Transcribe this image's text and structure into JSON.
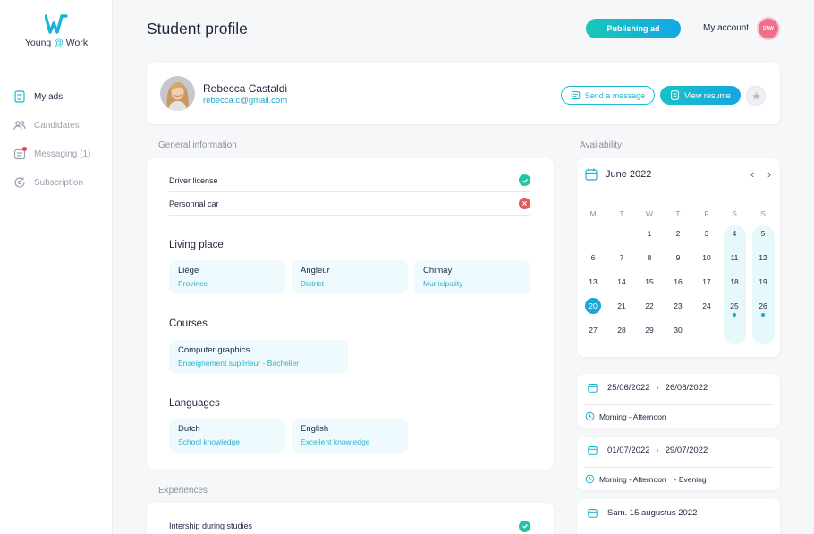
{
  "brand": {
    "name_left": "Young",
    "name_at": "@",
    "name_right": "Work"
  },
  "nav": [
    {
      "label": "My ads",
      "icon": "document-icon",
      "active": true
    },
    {
      "label": "Candidates",
      "icon": "users-icon",
      "active": false
    },
    {
      "label": "Messaging (1)",
      "icon": "message-icon",
      "active": false
    },
    {
      "label": "Subscription",
      "icon": "subscription-icon",
      "active": false
    }
  ],
  "header": {
    "title": "Student profile",
    "publish_label": "Publishing ad",
    "account_label": "My account",
    "account_badge": "DAW"
  },
  "profile": {
    "name": "Rebecca Castaldi",
    "email": "rebecca.c@gmail.com",
    "message_label": "Send a message",
    "resume_label": "View resume"
  },
  "general": {
    "section_label": "General information",
    "attributes": [
      {
        "label": "Driver license",
        "status": "ok"
      },
      {
        "label": "Personnal car",
        "status": "no"
      }
    ],
    "living_heading": "Living place",
    "living": [
      {
        "title": "Liège",
        "sub": "Province"
      },
      {
        "title": "Angleur",
        "sub": "District"
      },
      {
        "title": "Chimay",
        "sub": "Municipality"
      }
    ],
    "courses_heading": "Courses",
    "courses": [
      {
        "title": "Computer graphics",
        "sub": "Enseignement supérieur - Bachelier"
      }
    ],
    "languages_heading": "Languages",
    "languages": [
      {
        "title": "Dutch",
        "sub": "School knowledge"
      },
      {
        "title": "English",
        "sub": "Excellent knowledge"
      }
    ]
  },
  "experiences": {
    "section_label": "Experiences",
    "items": [
      {
        "label": "Intership during studies",
        "status": "ok"
      }
    ]
  },
  "availability": {
    "section_label": "Availability",
    "month": "June 2022",
    "weekdays": [
      "M",
      "T",
      "W",
      "T",
      "F",
      "S",
      "S"
    ],
    "weeks": [
      [
        "",
        "",
        "1",
        "2",
        "3",
        "4",
        "5"
      ],
      [
        "6",
        "7",
        "8",
        "9",
        "10",
        "11",
        "12"
      ],
      [
        "13",
        "14",
        "15",
        "16",
        "17",
        "18",
        "19"
      ],
      [
        "20",
        "21",
        "22",
        "23",
        "24",
        "25",
        "26"
      ],
      [
        "27",
        "28",
        "29",
        "30",
        "",
        "",
        ""
      ]
    ],
    "today": "20",
    "marked_days": [
      "25",
      "26"
    ],
    "slots": [
      {
        "from": "25/06/2022",
        "to": "26/06/2022",
        "times": "Morning - Afternoon",
        "extra": ""
      },
      {
        "from": "01/07/2022",
        "to": "29/07/2022",
        "times": "Morning - Afternoon",
        "extra": "- Evening"
      },
      {
        "from": "Sam. 15 augustus 2022",
        "to": "",
        "times": "",
        "extra": ""
      }
    ]
  },
  "colors": {
    "accent": "#18b4cf",
    "ok": "#1fc5a4",
    "error": "#e25a5a",
    "chip_bg": "#eefafd"
  }
}
